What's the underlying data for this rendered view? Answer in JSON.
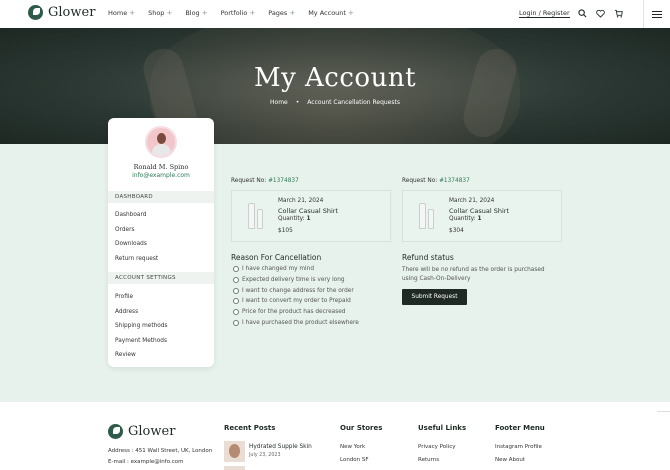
{
  "brand": {
    "name": "Glower"
  },
  "nav": [
    {
      "label": "Home"
    },
    {
      "label": "Shop"
    },
    {
      "label": "Blog"
    },
    {
      "label": "Portfolio"
    },
    {
      "label": "Pages"
    },
    {
      "label": "My Account"
    }
  ],
  "header": {
    "login_label": "Login / Register",
    "icons": [
      "search-icon",
      "heart-icon",
      "cart-icon",
      "menu-icon"
    ]
  },
  "hero": {
    "title": "My Account",
    "breadcrumb_home": "Home",
    "breadcrumb_sep": "•",
    "breadcrumb_current": "Account Cancellation Requests"
  },
  "profile": {
    "name": "Ronald M. Spino",
    "email": "info@example.com"
  },
  "sidebar": {
    "dashboard_heading": "DASHBOARD",
    "dashboard_links": [
      "Dashboard",
      "Orders",
      "Downloads",
      "Return request"
    ],
    "settings_heading": "ACCOUNT SETTINGS",
    "settings_links": [
      "Profile",
      "Address",
      "Shipping methods",
      "Payment Methods",
      "Review"
    ]
  },
  "requests": [
    {
      "label": "Request No:",
      "number": "#1374837",
      "date": "March 21, 2024",
      "product": "Collar Casual Shirt",
      "qty_label": "Quantity:",
      "qty": "1",
      "price": "$105"
    },
    {
      "label": "Request No:",
      "number": "#1374837",
      "date": "March 21, 2024",
      "product": "Collar Casual Shirt",
      "qty_label": "Quantity:",
      "qty": "1",
      "price": "$304"
    }
  ],
  "reason": {
    "title": "Reason For Cancellation",
    "options": [
      "I have changed my mind",
      "Expected delivery time is very long",
      "I want to change address for the order",
      "I want to convert my order to Prepaid",
      "Price for the product has decreased",
      "I have purchased the product elsewhere"
    ]
  },
  "refund": {
    "title": "Refund status",
    "text": "There will be no refund as the order is purchased using Cash-On-Delivery",
    "submit_label": "Submit Request"
  },
  "footer": {
    "address": "Address : 451 Wall Street, UK, London",
    "email": "E-mail : example@info.com",
    "recent_posts_heading": "Recent Posts",
    "post_title": "Hydrated Supple Skin",
    "post_date": "July 23, 2023",
    "stores_heading": "Our Stores",
    "stores": [
      "New York",
      "London SF"
    ],
    "useful_heading": "Useful Links",
    "useful": [
      "Privacy Policy",
      "Returns"
    ],
    "menu_heading": "Footer Menu",
    "menu": [
      "Instagram Profile",
      "New About"
    ]
  },
  "colors": {
    "accent": "#2f7a55",
    "dark": "#1f2a24",
    "mint": "#e7f2ec"
  }
}
